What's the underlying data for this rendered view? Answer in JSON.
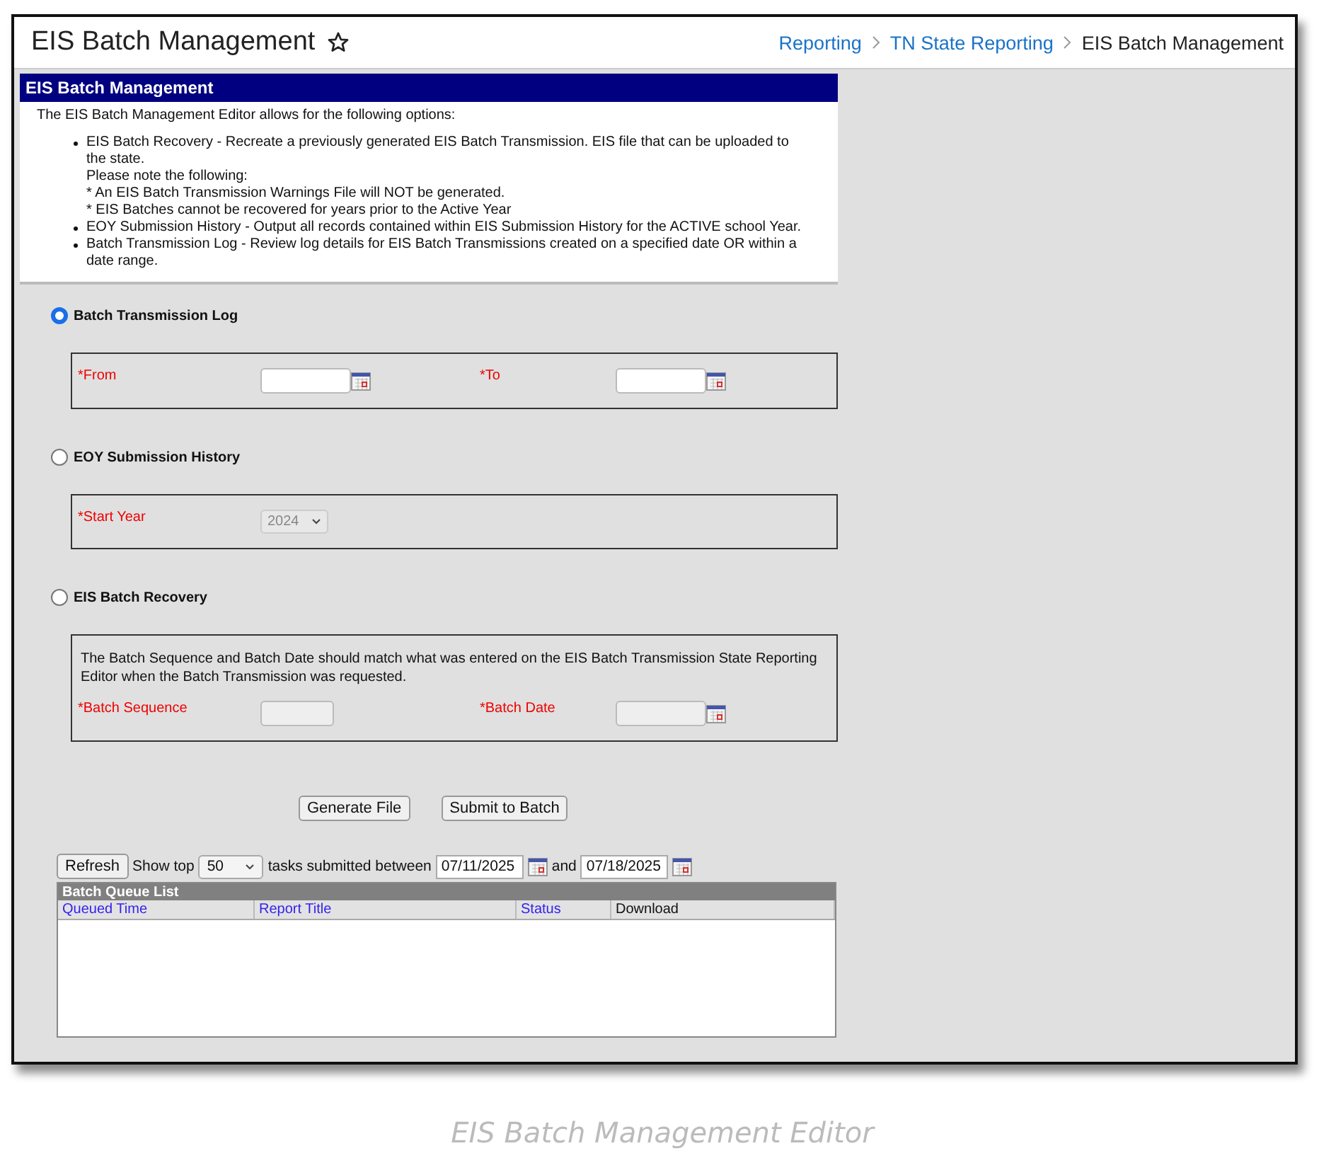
{
  "header": {
    "title": "EIS Batch Management",
    "favorite": false,
    "breadcrumbs": [
      {
        "label": "Reporting",
        "link": true
      },
      {
        "label": "TN State Reporting",
        "link": true
      },
      {
        "label": "EIS Batch Management",
        "link": false
      }
    ]
  },
  "panel": {
    "title": "EIS Batch Management",
    "intro": "The EIS Batch Management Editor allows for the following options:",
    "bullets": [
      {
        "lines": [
          "EIS Batch Recovery - Recreate a previously generated EIS Batch Transmission. EIS file that can be uploaded to the state.",
          "Please note the following:",
          "* An EIS Batch Transmission Warnings File will NOT be generated.",
          "* EIS Batches cannot be recovered for years prior to the Active Year"
        ]
      },
      {
        "lines": [
          "EOY Submission History - Output all records contained within EIS Submission History for the ACTIVE school Year."
        ]
      },
      {
        "lines": [
          "Batch Transmission Log - Review log details for EIS Batch Transmissions created on a specified date OR within a date range."
        ]
      }
    ]
  },
  "options": [
    {
      "label": "Batch Transmission Log",
      "selected": true,
      "fields": [
        {
          "kind": "date",
          "label": "*From",
          "disabled": false
        },
        {
          "kind": "date",
          "label": "*To",
          "disabled": false
        }
      ]
    },
    {
      "label": "EOY Submission History",
      "selected": false,
      "fields": [
        {
          "kind": "select",
          "label": "*Start Year",
          "value": "2024",
          "disabled": true
        }
      ]
    },
    {
      "label": "EIS Batch Recovery",
      "selected": false,
      "note": "The Batch Sequence and Batch Date should match what was entered on the EIS Batch Transmission State Reporting Editor when the Batch Transmission was requested.",
      "fields": [
        {
          "kind": "text",
          "label": "*Batch Sequence",
          "disabled": true
        },
        {
          "kind": "date",
          "label": "*Batch Date",
          "disabled": true
        }
      ]
    }
  ],
  "buttons": [
    "Generate File",
    "Submit to Batch"
  ],
  "queue": {
    "refresh": "Refresh",
    "show_top": "Show top",
    "count": "50",
    "between": "tasks submitted between",
    "from": "07/11/2025",
    "and": "and",
    "to": "07/18/2025",
    "title": "Batch Queue List",
    "columns": [
      {
        "label": "Queued Time",
        "sortable": true
      },
      {
        "label": "Report Title",
        "sortable": true
      },
      {
        "label": "Status",
        "sortable": true
      },
      {
        "label": "Download",
        "sortable": false
      }
    ]
  },
  "caption": "EIS Batch Management Editor"
}
